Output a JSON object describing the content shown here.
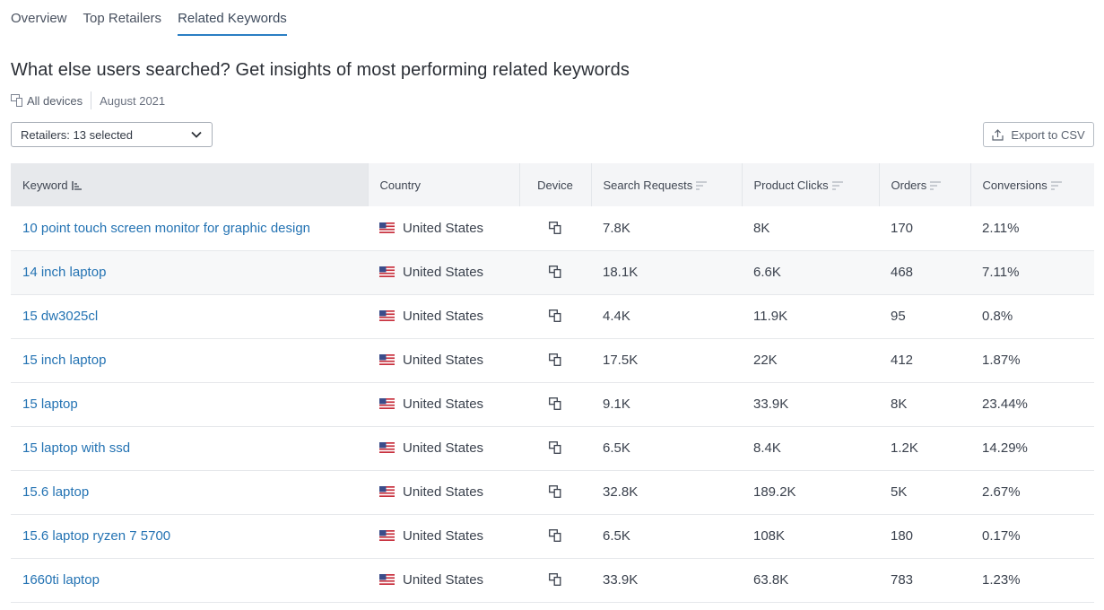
{
  "tabs": [
    {
      "label": "Overview"
    },
    {
      "label": "Top Retailers"
    },
    {
      "label": "Related Keywords"
    }
  ],
  "page_title": "What else users searched? Get insights of most performing related keywords",
  "meta": {
    "device_label": "All devices",
    "date_label": "August 2021"
  },
  "filters": {
    "retailers_label": "Retailers: 13 selected"
  },
  "toolbar": {
    "export_label": "Export to CSV"
  },
  "table": {
    "columns": [
      {
        "label": "Keyword"
      },
      {
        "label": "Country"
      },
      {
        "label": "Device"
      },
      {
        "label": "Search Requests"
      },
      {
        "label": "Product Clicks"
      },
      {
        "label": "Orders"
      },
      {
        "label": "Conversions"
      }
    ],
    "rows": [
      {
        "keyword": "10 point touch screen monitor for graphic design",
        "country": "United States",
        "search_requests": "7.8K",
        "product_clicks": "8K",
        "orders": "170",
        "conversions": "2.11%"
      },
      {
        "keyword": "14 inch laptop",
        "country": "United States",
        "search_requests": "18.1K",
        "product_clicks": "6.6K",
        "orders": "468",
        "conversions": "7.11%"
      },
      {
        "keyword": "15 dw3025cl",
        "country": "United States",
        "search_requests": "4.4K",
        "product_clicks": "11.9K",
        "orders": "95",
        "conversions": "0.8%"
      },
      {
        "keyword": "15 inch laptop",
        "country": "United States",
        "search_requests": "17.5K",
        "product_clicks": "22K",
        "orders": "412",
        "conversions": "1.87%"
      },
      {
        "keyword": "15 laptop",
        "country": "United States",
        "search_requests": "9.1K",
        "product_clicks": "33.9K",
        "orders": "8K",
        "conversions": "23.44%"
      },
      {
        "keyword": "15 laptop with ssd",
        "country": "United States",
        "search_requests": "6.5K",
        "product_clicks": "8.4K",
        "orders": "1.2K",
        "conversions": "14.29%"
      },
      {
        "keyword": "15.6 laptop",
        "country": "United States",
        "search_requests": "32.8K",
        "product_clicks": "189.2K",
        "orders": "5K",
        "conversions": "2.67%"
      },
      {
        "keyword": "15.6 laptop ryzen 7 5700",
        "country": "United States",
        "search_requests": "6.5K",
        "product_clicks": "108K",
        "orders": "180",
        "conversions": "0.17%"
      },
      {
        "keyword": "1660ti laptop",
        "country": "United States",
        "search_requests": "33.9K",
        "product_clicks": "63.8K",
        "orders": "783",
        "conversions": "1.23%"
      }
    ]
  },
  "icons": {
    "device": "devices-icon",
    "flag": "us-flag-icon",
    "sort": "sort-icon",
    "export": "upload-icon",
    "dropdown": "chevron-down-icon"
  },
  "colors": {
    "accent": "#2a7fc4",
    "link": "#2473b3",
    "header_bg": "#f4f5f7"
  }
}
